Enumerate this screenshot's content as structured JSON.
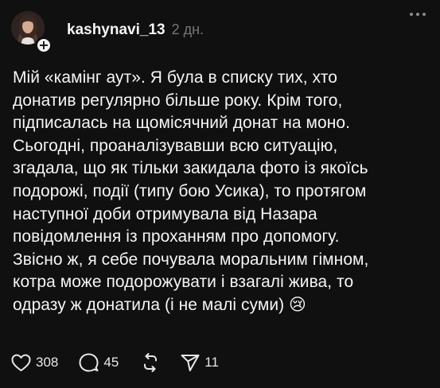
{
  "post": {
    "username": "kashynavi_13",
    "time": "2 дн.",
    "lines": [
      "Мій «камінг аут». Я була в списку тих, хто",
      "донатив регулярно більше року. Крім того,",
      "підписалась на щомісячний донат на моно.",
      "Сьогодні, проаналізувавши всю ситуацію,",
      "згадала, що як тільки закидала фото із якоїсь",
      "подорожі, події (типу бою Усика), то протягом",
      "наступної доби отримувала від Назара",
      "повідомлення із проханням про допомогу.",
      "Звісно ж, я себе почувала моральним гімном,",
      "котра може подорожувати і взагалі жива, то",
      "одразу ж донатила (і не малі суми) 😢"
    ],
    "follow_badge": "+",
    "stats": {
      "likes": "308",
      "replies": "45",
      "shares": "11"
    }
  },
  "icons": {
    "like": "heart-icon",
    "reply": "comment-icon",
    "repost": "repost-icon",
    "share": "send-icon",
    "more": "more-icon"
  }
}
